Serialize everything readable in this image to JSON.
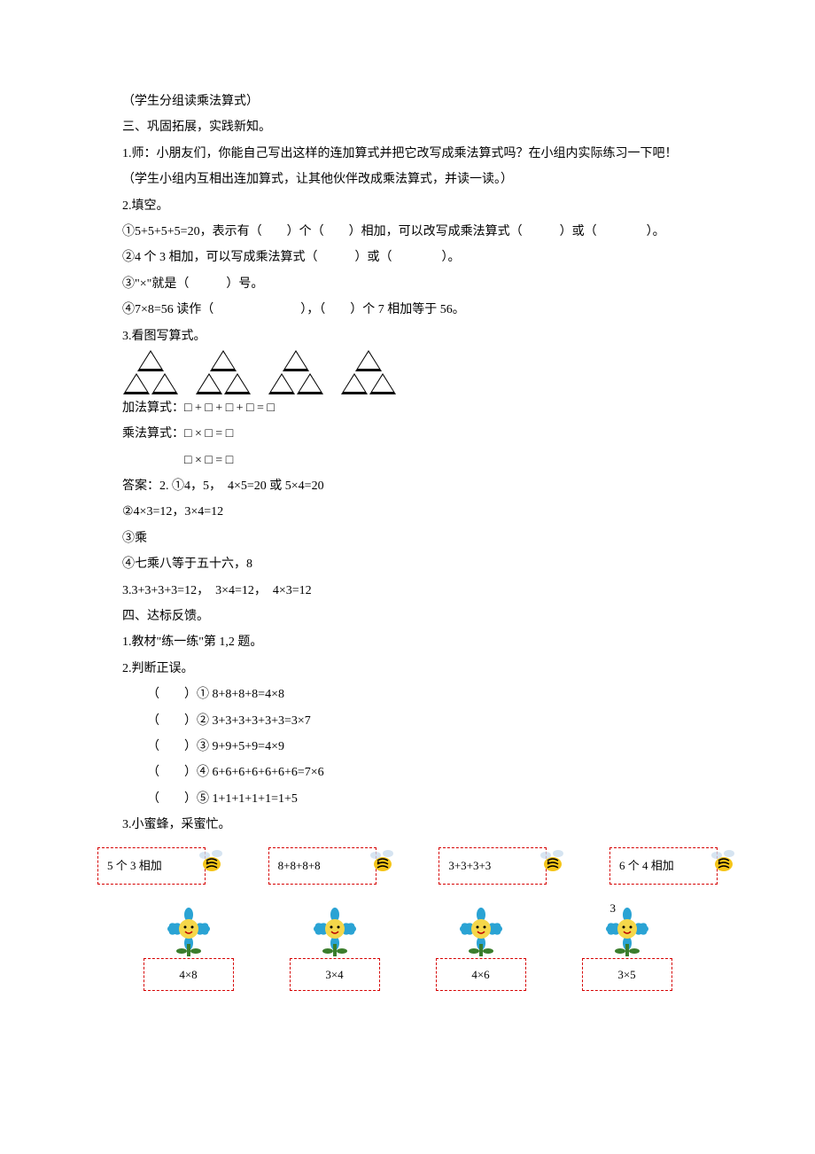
{
  "lines": {
    "l1": "（学生分组读乘法算式）",
    "l2": "三、巩固拓展，实践新知。",
    "l3": "1.师：小朋友们，你能自己写出这样的连加算式并把它改写成乘法算式吗？在小组内实际练习一下吧！",
    "l4": "（学生小组内互相出连加算式，让其他伙伴改成乘法算式，并读一读。）",
    "l5": "2.填空。",
    "l6": "①5+5+5+5=20，表示有（　　）个（　　）相加，可以改写成乘法算式（　　　）或（　　　　）。",
    "l7": "②4 个 3 相加，可以写成乘法算式（　　　）或（　　　　）。",
    "l8": "③\"×\"就是（　　　）号。",
    "l9": "④7×8=56 读作（　　　　　　　），（　　）个 7 相加等于 56。",
    "l10": "3.看图写算式。",
    "l11": "加法算式：□ + □ + □ + □ = □",
    "l12": "乘法算式：□ × □ = □",
    "l13": "　　　　　□ × □ = □",
    "l14": "答案：2. ①4，5，　4×5=20 或 5×4=20",
    "l15": "②4×3=12，3×4=12",
    "l16": "③乘",
    "l17": "④七乘八等于五十六，8",
    "l18": "3.3+3+3+3=12，　3×4=12，　4×3=12",
    "l19": "四、达标反馈。",
    "l20": "1.教材\"练一练\"第 1,2 题。",
    "l21": "2.判断正误。",
    "j1": "（　　）① 8+8+8+8=4×8",
    "j2": "（　　）② 3+3+3+3+3+3=3×7",
    "j3": "（　　）③ 9+9+5+9=4×9",
    "j4": "（　　）④ 6+6+6+6+6+6+6=7×6",
    "j5": "（　　）⑤ 1+1+1+1+1=1+5",
    "l22": "3.小蜜蜂，采蜜忙。"
  },
  "bees": {
    "b1": "5 个 3 相加",
    "b2": "8+8+8+8",
    "b3": "3+3+3+3",
    "b4": "6 个 4 相加"
  },
  "flowers": {
    "f1": "4×8",
    "f2": "3×4",
    "f3": "4×6",
    "f4": "3×5"
  },
  "pageNumber": "3"
}
